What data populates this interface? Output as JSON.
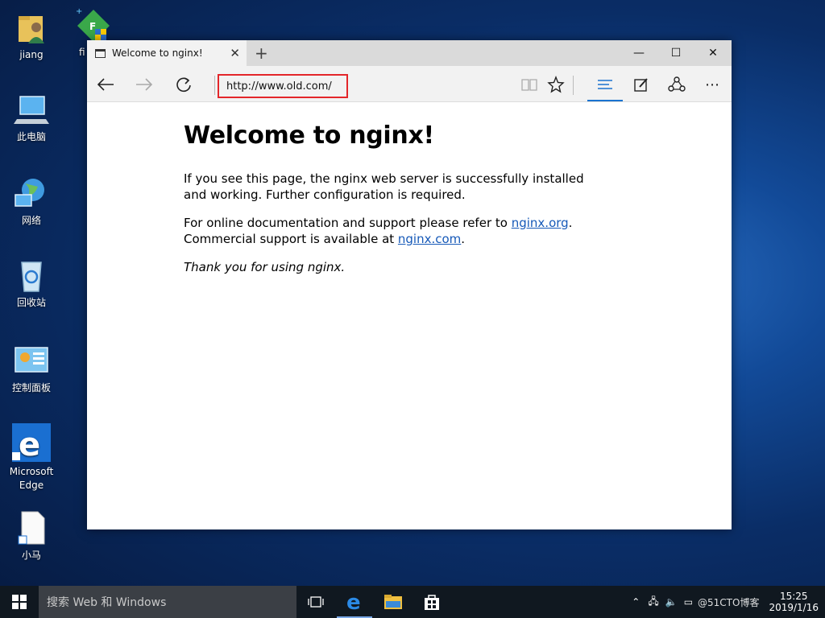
{
  "desktop": {
    "icons": [
      {
        "label": "jiang"
      },
      {
        "label": "此电脑"
      },
      {
        "label": "网络"
      },
      {
        "label": "回收站"
      },
      {
        "label": "控制面板"
      },
      {
        "label": "Microsoft Edge"
      },
      {
        "label": "小马"
      }
    ],
    "partial_icon_label": "fi"
  },
  "browser": {
    "tab_title": "Welcome to nginx!",
    "address": "http://www.old.com/",
    "page": {
      "heading": "Welcome to nginx!",
      "p1": "If you see this page, the nginx web server is successfully installed and working. Further configuration is required.",
      "p2_prefix": "For online documentation and support please refer to ",
      "p2_link": "nginx.org",
      "p2_mid": ".",
      "p2_line2_prefix": "Commercial support is available at ",
      "p2_link2": "nginx.com",
      "p2_end": ".",
      "thanks": "Thank you for using nginx."
    }
  },
  "taskbar": {
    "search_placeholder": "搜索 Web 和 Windows",
    "time": "15:25",
    "date": "2019/1/16",
    "watermark": "@51CTO博客"
  },
  "colors": {
    "accent": "#1a73d0",
    "address_highlight": "#e3262a",
    "link": "#1659b8"
  }
}
